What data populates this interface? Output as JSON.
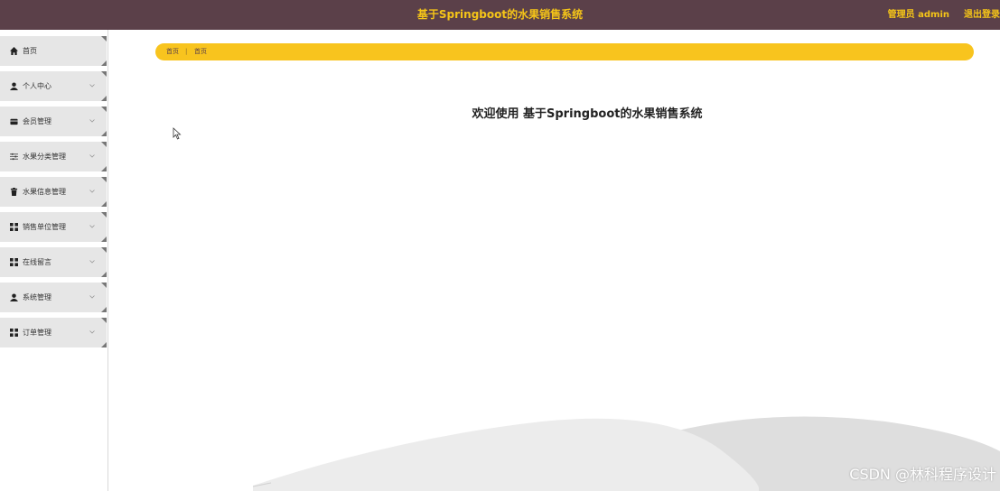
{
  "header": {
    "title": "基于Springboot的水果销售系统",
    "user": "管理员 admin",
    "logout": "退出登录"
  },
  "sidebar": {
    "items": [
      {
        "label": "首页",
        "icon": "home-icon",
        "has_chevron": false
      },
      {
        "label": "个人中心",
        "icon": "user-icon",
        "has_chevron": true
      },
      {
        "label": "会员管理",
        "icon": "card-icon",
        "has_chevron": true
      },
      {
        "label": "水果分类管理",
        "icon": "sliders-icon",
        "has_chevron": true
      },
      {
        "label": "水果信息管理",
        "icon": "trash-icon",
        "has_chevron": true
      },
      {
        "label": "销售单位管理",
        "icon": "grid-icon",
        "has_chevron": true
      },
      {
        "label": "在线留言",
        "icon": "grid-icon",
        "has_chevron": true
      },
      {
        "label": "系统管理",
        "icon": "user-icon",
        "has_chevron": true
      },
      {
        "label": "订单管理",
        "icon": "grid-icon",
        "has_chevron": true
      }
    ]
  },
  "breadcrumb": {
    "root": "首页",
    "separator": "|",
    "current": "首页"
  },
  "main": {
    "welcome": "欢迎使用 基于Springboot的水果销售系统"
  },
  "watermark": "CSDN @林科程序设计",
  "colors": {
    "topbar": "#5b4049",
    "accent": "#f8c41e",
    "menu_bg": "#e6e6e6"
  }
}
